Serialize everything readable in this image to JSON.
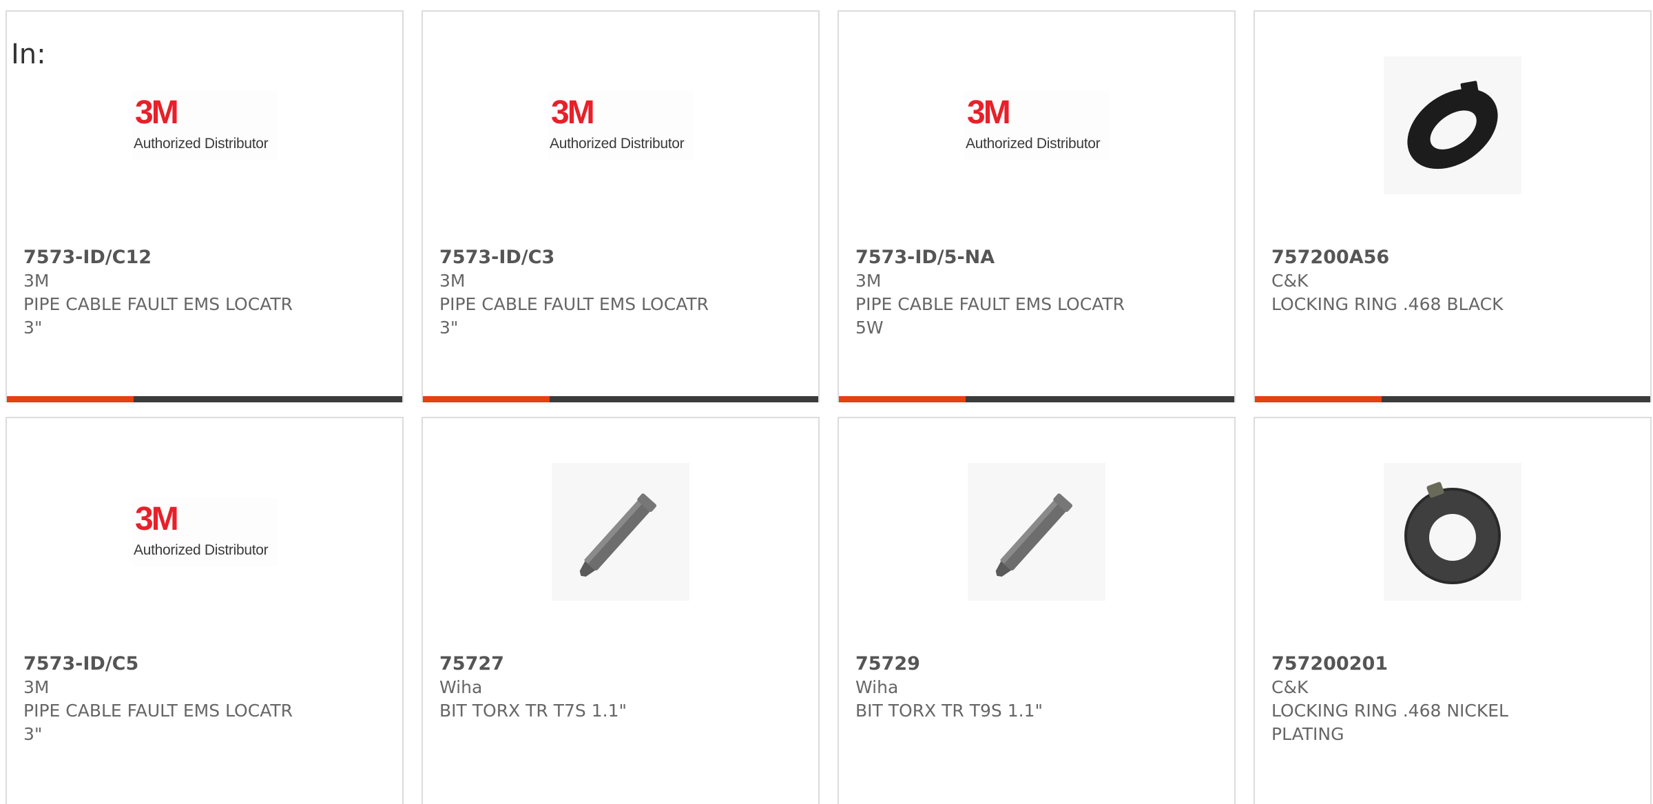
{
  "header": {
    "in_label": "In:"
  },
  "colors": {
    "accent": "#e5400f",
    "bar": "#3b3b3b",
    "brand_3m": "#e8202a"
  },
  "products": [
    {
      "part": "7573-ID/C12",
      "brand": "3M",
      "desc": "PIPE CABLE FAULT EMS LOCATR\n3\"",
      "image": "3m-authorized-distributor-logo",
      "logo_mark": "3M",
      "logo_text": "Authorized Distributor"
    },
    {
      "part": "7573-ID/C3",
      "brand": "3M",
      "desc": "PIPE CABLE FAULT EMS LOCATR\n3\"",
      "image": "3m-authorized-distributor-logo",
      "logo_mark": "3M",
      "logo_text": "Authorized Distributor"
    },
    {
      "part": "7573-ID/5-NA",
      "brand": "3M",
      "desc": "PIPE CABLE FAULT EMS LOCATR\n5W",
      "image": "3m-authorized-distributor-logo",
      "logo_mark": "3M",
      "logo_text": "Authorized Distributor"
    },
    {
      "part": "757200A56",
      "brand": "C&K",
      "desc": "LOCKING RING .468 BLACK",
      "image": "black-locking-ring-photo"
    },
    {
      "part": "7573-ID/C5",
      "brand": "3M",
      "desc": "PIPE CABLE FAULT EMS LOCATR\n3\"",
      "image": "3m-authorized-distributor-logo",
      "logo_mark": "3M",
      "logo_text": "Authorized Distributor"
    },
    {
      "part": "75727",
      "brand": "Wiha",
      "desc": "BIT TORX TR T7S 1.1\"",
      "image": "torx-bit-photo"
    },
    {
      "part": "75729",
      "brand": "Wiha",
      "desc": "BIT TORX TR T9S 1.1\"",
      "image": "torx-bit-photo"
    },
    {
      "part": "757200201",
      "brand": "C&K",
      "desc": "LOCKING RING .468 NICKEL\nPLATING",
      "image": "nickel-locking-ring-photo"
    }
  ]
}
